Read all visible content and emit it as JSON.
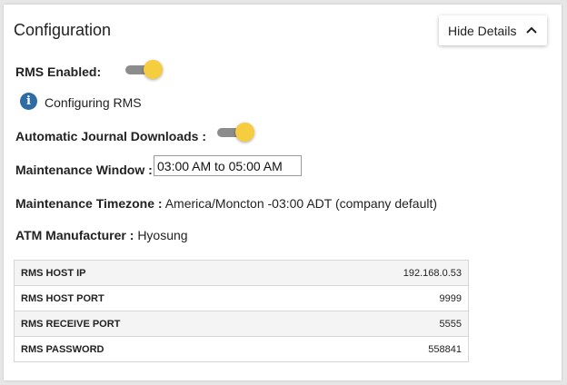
{
  "header": {
    "title": "Configuration",
    "hide_details_label": "Hide Details"
  },
  "rms_enabled": {
    "label": "RMS Enabled:",
    "on": true
  },
  "info_message": "Configuring RMS",
  "auto_journal": {
    "label": "Automatic Journal Downloads :",
    "on": true
  },
  "maintenance_window": {
    "label": "Maintenance Window :",
    "value": "03:00 AM to 05:00 AM"
  },
  "maintenance_timezone": {
    "label": "Maintenance Timezone :",
    "value": "America/Moncton -03:00 ADT (company default)"
  },
  "atm_manufacturer": {
    "label": "ATM Manufacturer :",
    "value": "Hyosung"
  },
  "rms_table": [
    {
      "key": "RMS HOST IP",
      "value": "192.168.0.53"
    },
    {
      "key": "RMS HOST PORT",
      "value": "9999"
    },
    {
      "key": "RMS RECEIVE PORT",
      "value": "5555"
    },
    {
      "key": "RMS PASSWORD",
      "value": "558841"
    }
  ],
  "colors": {
    "toggle_thumb": "#f6cd3e",
    "toggle_track": "#8c8c8c",
    "info_icon": "#2f6ca3"
  },
  "icons": {
    "info": "info-icon",
    "chevron": "chevron-up-icon"
  }
}
